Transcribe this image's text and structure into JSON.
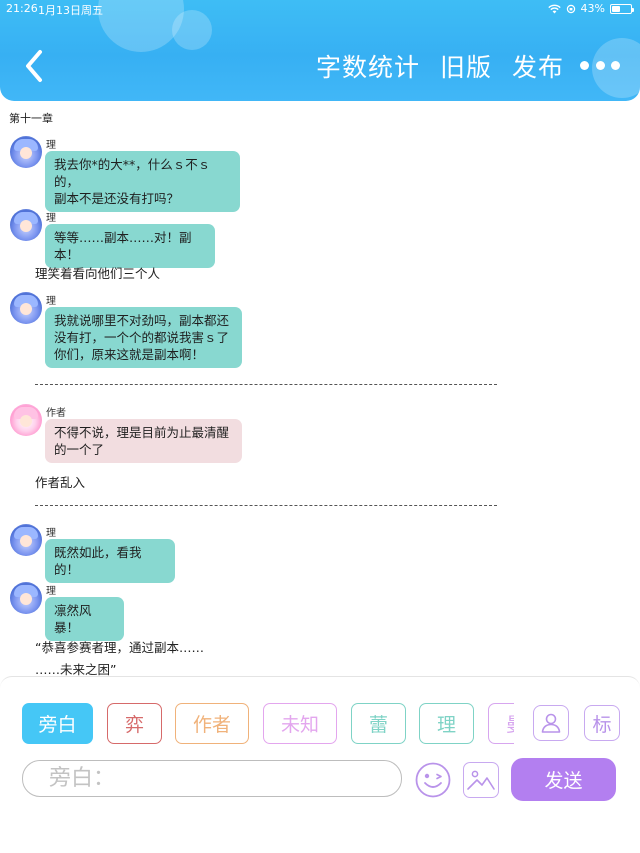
{
  "status_bar": {
    "time": "21:26",
    "date": "1月13日周五",
    "battery": "43%",
    "battery_level": 0.43
  },
  "header": {
    "back_icon": "chevron-left-icon",
    "actions": [
      "字数统计",
      "旧版",
      "发布"
    ],
    "more_icon": "more-dots-icon"
  },
  "chat": {
    "chapter_title": "第十一章",
    "messages": [
      {
        "name": "理",
        "lines": [
          "我去你*的大**，什么ｓ不ｓ的，",
          "副本不是还没有打吗？"
        ]
      },
      {
        "name": "理",
        "lines": [
          "等等……副本……对！副本！"
        ]
      },
      {
        "narration": "理笑着看向他们三个人"
      },
      {
        "name": "理",
        "lines": [
          "我就说哪里不对劲吗，副本都还",
          "没有打，一个个的都说我害ｓ了",
          "你们，原来这就是副本啊！"
        ]
      },
      {
        "divider": "----------------------------------------------------------------------------------------------------------"
      },
      {
        "name": "作者",
        "lines": [
          "不得不说，理是目前为止最清醒",
          "的一个了"
        ]
      },
      {
        "narration": "作者乱入"
      },
      {
        "divider": "----------------------------------------------------------------------------------------------------------"
      },
      {
        "name": "理",
        "lines": [
          "既然如此，看我的！"
        ]
      },
      {
        "name": "理",
        "lines": [
          "凛然风暴！"
        ]
      },
      {
        "narration": "“恭喜参赛者理，通过副本……"
      },
      {
        "narration": "……未来之困”"
      }
    ]
  },
  "roles": [
    {
      "label": "旁白",
      "color": "#45c7f6",
      "active": true
    },
    {
      "label": "弈",
      "color": "#d66a6a",
      "active": false
    },
    {
      "label": "作者",
      "color": "#f0b27a",
      "active": false
    },
    {
      "label": "未知",
      "color": "#e3a6ee",
      "active": false
    },
    {
      "label": "蕾",
      "color": "#7fd3c6",
      "active": false
    },
    {
      "label": "理",
      "color": "#7fd3c6",
      "active": false
    },
    {
      "label": "曼",
      "color": "#d7a6ef",
      "active": false
    }
  ],
  "toolbar": {
    "role_manage_icon": "user-manage-icon",
    "tag_label": "标",
    "input_placeholder": "旁白：",
    "emoji_icon": "emoji-icon",
    "image_icon": "image-icon",
    "send_label": "发送"
  },
  "colors": {
    "header_blue": "#3ebdf5",
    "bubble_teal": "#88d8d0",
    "bubble_pink": "#f2dde0",
    "send_purple": "#b37ff0",
    "accent_purple_outline": "#c8a9f0"
  }
}
